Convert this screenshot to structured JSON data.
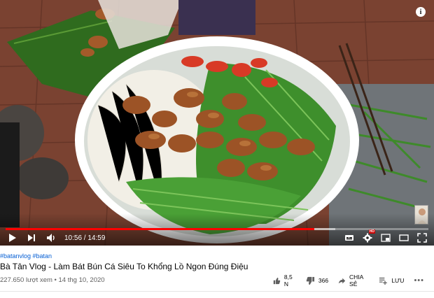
{
  "player": {
    "current_time": "10:56",
    "duration": "14:59",
    "time_separator": " / ",
    "progress": 0.73,
    "buffered": 0.78,
    "info_label": "i"
  },
  "video": {
    "hashtags": "#batanvlog #batan",
    "title": "Bà Tân Vlog - Làm Bát Bún Cá Siêu To Khổng Lồ Ngon Đúng Điệu",
    "views": "227.650 lượt xem",
    "meta_separator": " • ",
    "date": "14 thg 10, 2020"
  },
  "actions": {
    "likes": "8,5 N",
    "dislikes": "366",
    "share_label": "CHIA SẺ",
    "save_label": "LƯU",
    "more_label": "•••"
  },
  "colors": {
    "progress": "#ff0000",
    "hashtag": "#065fd4",
    "meta": "#606060"
  }
}
